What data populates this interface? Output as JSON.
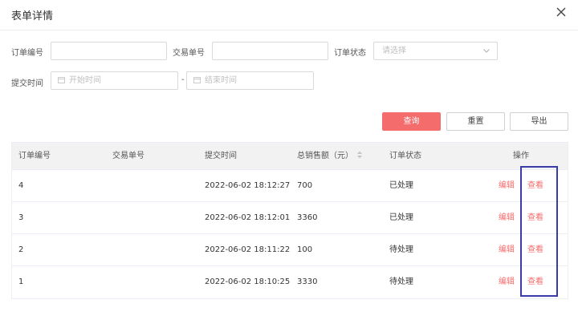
{
  "dialog": {
    "title": "表单详情"
  },
  "filters": {
    "order_no_label": "订单编号",
    "trade_no_label": "交易单号",
    "status_label": "订单状态",
    "status_placeholder": "请选择",
    "submit_time_label": "提交时间",
    "start_placeholder": "开始时间",
    "end_placeholder": "结束时间",
    "range_separator": "-"
  },
  "actions": {
    "query": "查询",
    "reset": "重置",
    "export": "导出"
  },
  "table": {
    "headers": {
      "order_no": "订单编号",
      "trade_no": "交易单号",
      "submit_time": "提交时间",
      "total_sales": "总销售额（元）",
      "status": "订单状态",
      "ops": "操作"
    },
    "rows": [
      {
        "order_no": "4",
        "trade_no": "",
        "submit_time": "2022-06-02 18:12:27",
        "total_sales": "700",
        "status": "已处理",
        "edit": "编辑",
        "view": "查看"
      },
      {
        "order_no": "3",
        "trade_no": "",
        "submit_time": "2022-06-02 18:12:01",
        "total_sales": "3360",
        "status": "已处理",
        "edit": "编辑",
        "view": "查看"
      },
      {
        "order_no": "2",
        "trade_no": "",
        "submit_time": "2022-06-02 18:11:22",
        "total_sales": "100",
        "status": "待处理",
        "edit": "编辑",
        "view": "查看"
      },
      {
        "order_no": "1",
        "trade_no": "",
        "submit_time": "2022-06-02 18:10:25",
        "total_sales": "3330",
        "status": "待处理",
        "edit": "编辑",
        "view": "查看"
      }
    ]
  },
  "colors": {
    "accent": "#f56c6c",
    "highlight_border": "#3a3aa8"
  },
  "icons": {
    "close": "close-icon",
    "chevron": "chevron-down-icon",
    "calendar": "calendar-icon",
    "sort": "sort-icon"
  }
}
